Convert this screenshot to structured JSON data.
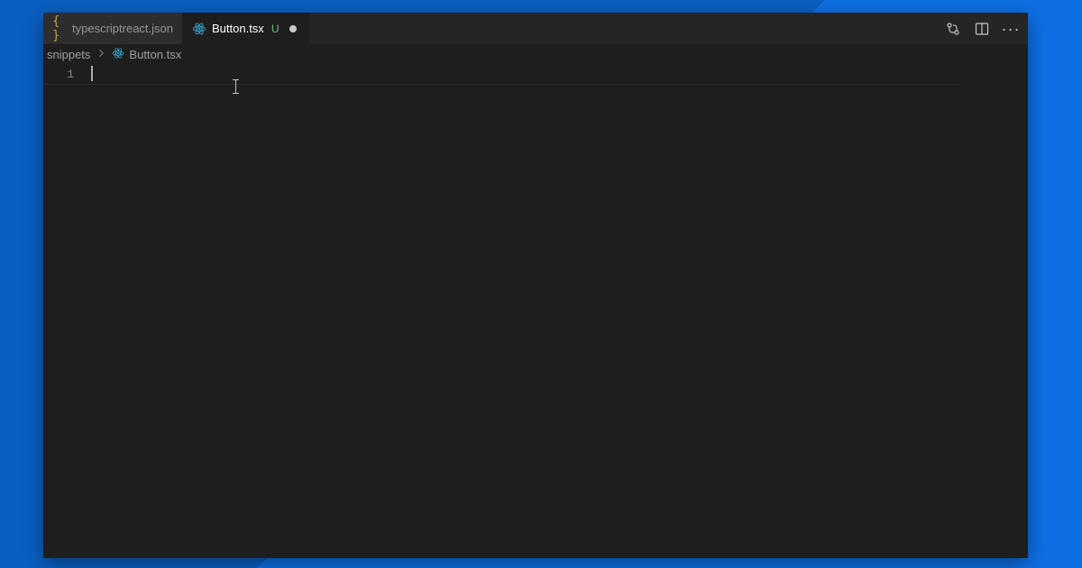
{
  "tabs": [
    {
      "label": "typescriptreact.json",
      "icon": "json-icon",
      "status": "",
      "dirty": false,
      "active": false
    },
    {
      "label": "Button.tsx",
      "icon": "react-icon",
      "status": "U",
      "dirty": true,
      "active": true
    }
  ],
  "breadcrumb": {
    "segments": [
      {
        "label": "snippets",
        "icon": ""
      },
      {
        "label": "Button.tsx",
        "icon": "react-icon"
      }
    ]
  },
  "editor": {
    "line_numbers": [
      "1"
    ],
    "content": ""
  },
  "actions": {
    "compare": "compare-changes",
    "split": "split-editor",
    "more": "more-actions"
  }
}
